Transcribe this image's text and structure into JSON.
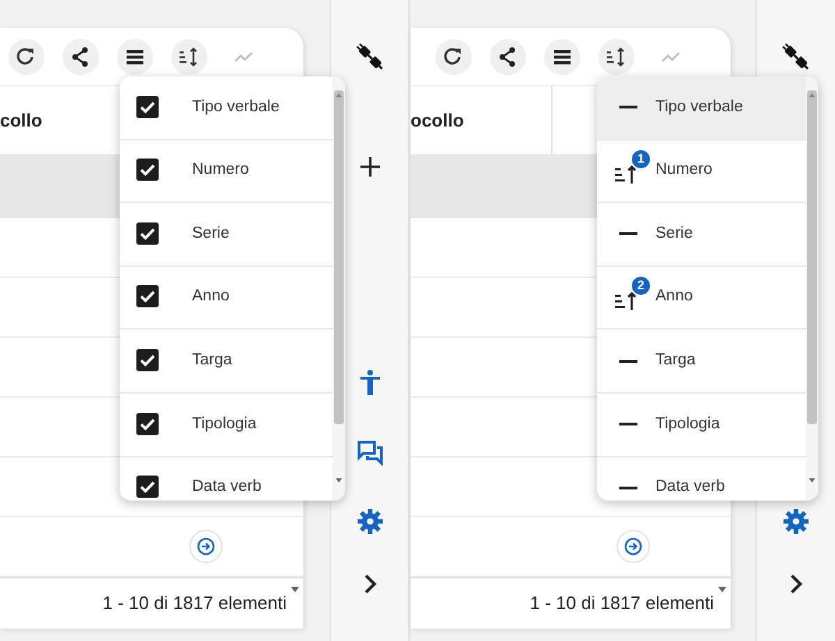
{
  "panels": [
    {
      "toolbar": [
        {
          "kind": "refresh",
          "disabled": false
        },
        {
          "kind": "share",
          "disabled": false
        },
        {
          "kind": "columns",
          "disabled": false
        },
        {
          "kind": "sort",
          "disabled": false
        },
        {
          "kind": "chart",
          "disabled": true
        }
      ],
      "columns": [
        "collo"
      ],
      "row_actions": [
        {
          "kind": "go"
        }
      ],
      "footer": "1 - 10 di 1817 elementi",
      "rail": [
        {
          "kind": "plug"
        },
        {
          "kind": "plus"
        },
        {
          "kind": "accessibility"
        },
        {
          "kind": "chat"
        },
        {
          "kind": "gear"
        },
        {
          "kind": "chevron"
        }
      ],
      "menu": {
        "kind": "columns",
        "items": [
          {
            "label": "Tipo verbale",
            "checked": true
          },
          {
            "label": "Numero",
            "checked": true
          },
          {
            "label": "Serie",
            "checked": true
          },
          {
            "label": "Anno",
            "checked": true
          },
          {
            "label": "Targa",
            "checked": true
          },
          {
            "label": "Tipologia",
            "checked": true
          },
          {
            "label": "Data verb",
            "checked": true
          }
        ]
      }
    },
    {
      "toolbar": [
        {
          "kind": "refresh",
          "disabled": false
        },
        {
          "kind": "share",
          "disabled": false
        },
        {
          "kind": "columns",
          "disabled": false
        },
        {
          "kind": "sort",
          "disabled": false
        },
        {
          "kind": "chart",
          "disabled": true
        }
      ],
      "columns": [
        "ocollo",
        ""
      ],
      "row_actions": [
        {
          "kind": "go"
        }
      ],
      "footer": "1 - 10 di 1817 elementi",
      "rail": [
        {
          "kind": "plug"
        },
        {
          "kind": "gear"
        },
        {
          "kind": "chevron"
        }
      ],
      "menu": {
        "kind": "sort",
        "items": [
          {
            "label": "Tipo verbale",
            "sorted": false,
            "hovered": true
          },
          {
            "label": "Numero",
            "sorted": true,
            "rank": "1",
            "hovered": false
          },
          {
            "label": "Serie",
            "sorted": false,
            "hovered": false
          },
          {
            "label": "Anno",
            "sorted": true,
            "rank": "2",
            "hovered": false
          },
          {
            "label": "Targa",
            "sorted": false,
            "hovered": false
          },
          {
            "label": "Tipologia",
            "sorted": false,
            "hovered": false
          },
          {
            "label": "Data verb",
            "sorted": false,
            "hovered": false
          }
        ]
      }
    }
  ]
}
